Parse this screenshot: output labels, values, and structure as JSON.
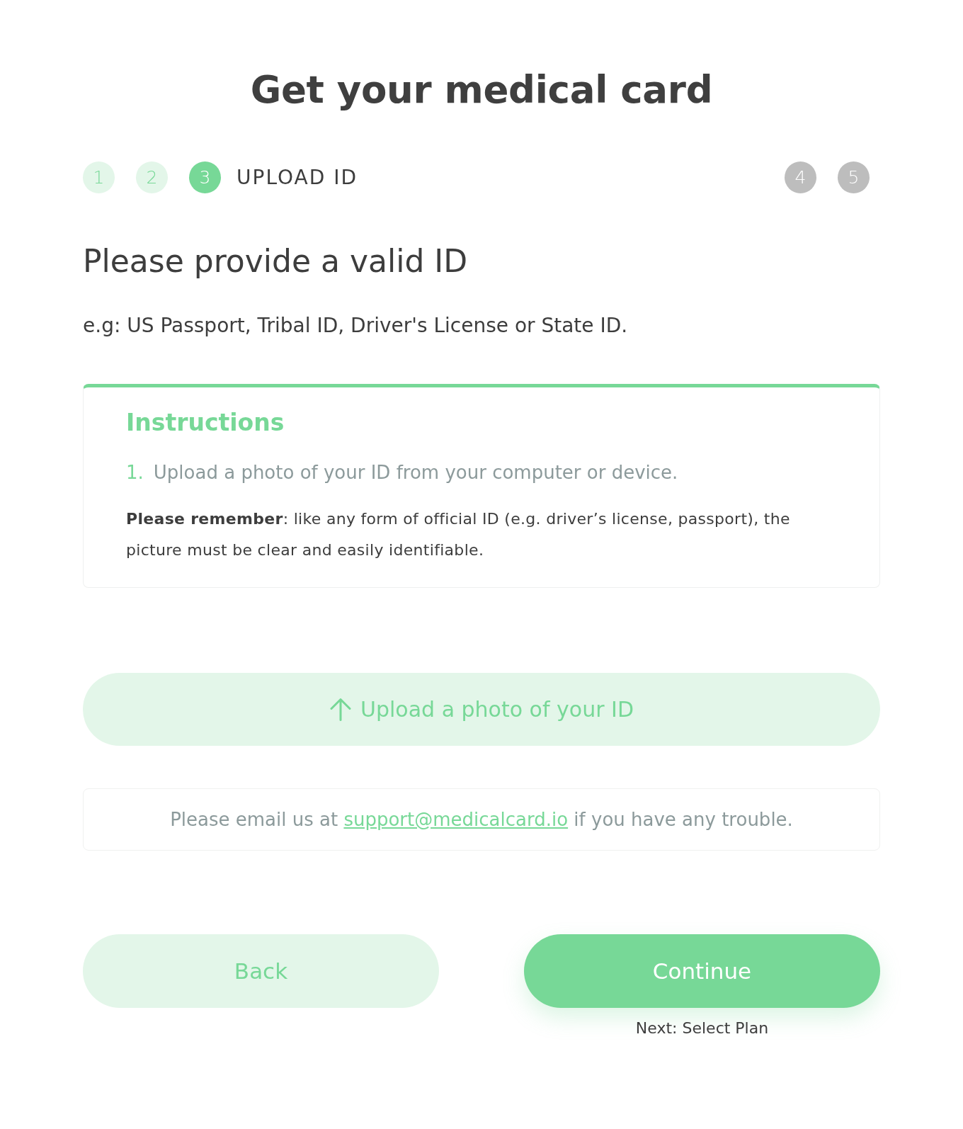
{
  "title": "Get your medical card",
  "stepper": {
    "steps": [
      {
        "number": "1",
        "completed": true,
        "selected": false
      },
      {
        "number": "2",
        "completed": true,
        "selected": false
      },
      {
        "number": "3",
        "completed": false,
        "selected": true,
        "label": "UPLOAD ID"
      },
      {
        "number": "4",
        "completed": false,
        "selected": false
      },
      {
        "number": "5",
        "completed": false,
        "selected": false
      }
    ]
  },
  "heading": "Please provide a valid ID",
  "subheading": "e.g: US Passport, Tribal ID, Driver's License or State ID.",
  "instructions": {
    "title": "Instructions",
    "steps": [
      {
        "number": "1.",
        "text": "Upload a photo of your ID from your computer or device."
      }
    ],
    "note": "**Please remember**: like any form of official ID (e.g. driver’s license, passport), the picture must be clear and easily identifiable."
  },
  "upload_button": {
    "label": "Upload a photo of your ID"
  },
  "help": {
    "text_before": "Please email us at",
    "link": "support@medicalcard.io",
    "text_after": "if you have any trouble."
  },
  "buttons": [
    {
      "label": "Back",
      "kind": "secondary"
    },
    {
      "label": "Continue",
      "kind": "primary",
      "hint": "Next: Select Plan"
    }
  ]
}
